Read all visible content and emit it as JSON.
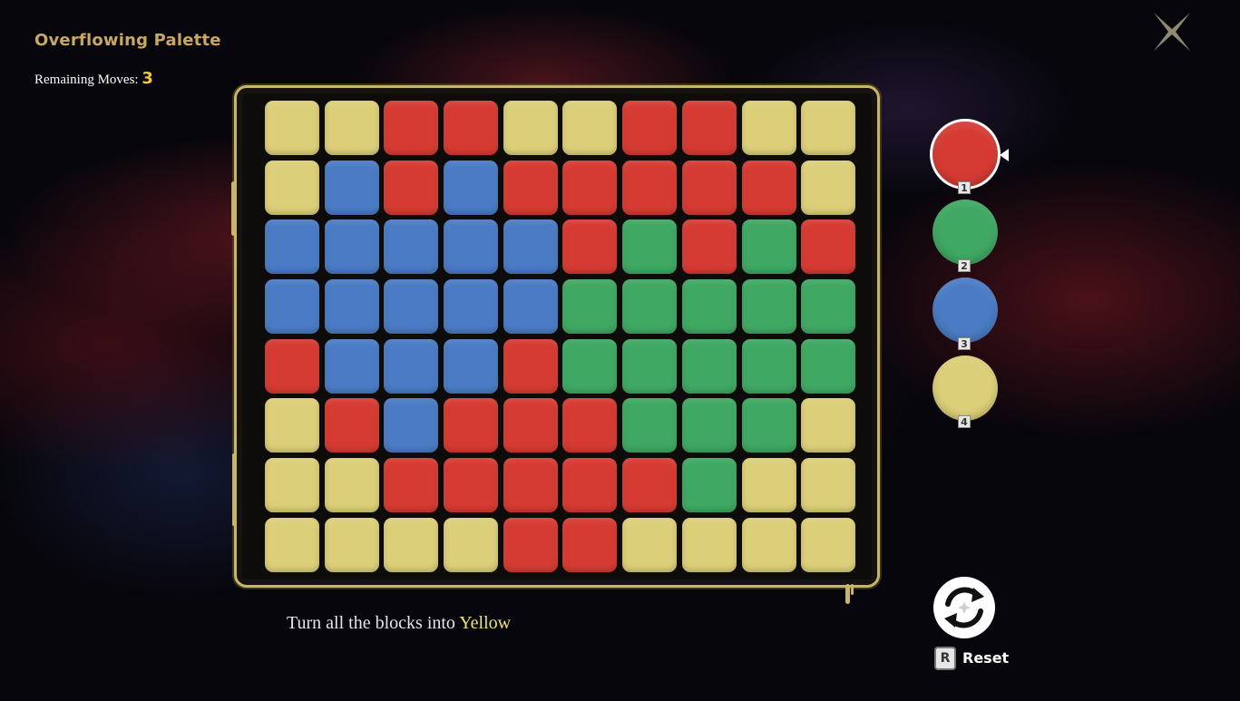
{
  "game": {
    "title": "Overflowing Palette",
    "moves_label": "Remaining Moves:",
    "moves_value": "3"
  },
  "colors": {
    "R": "#d53b33",
    "G": "#3fa863",
    "B": "#4a7bc4",
    "Y": "#dccf79"
  },
  "grid": {
    "rows": 8,
    "cols": 10,
    "cells": [
      [
        "Y",
        "Y",
        "R",
        "R",
        "Y",
        "Y",
        "R",
        "R",
        "Y",
        "Y"
      ],
      [
        "Y",
        "B",
        "R",
        "B",
        "R",
        "R",
        "R",
        "R",
        "R",
        "Y"
      ],
      [
        "B",
        "B",
        "B",
        "B",
        "B",
        "R",
        "G",
        "R",
        "G",
        "R"
      ],
      [
        "B",
        "B",
        "B",
        "B",
        "B",
        "G",
        "G",
        "G",
        "G",
        "G"
      ],
      [
        "R",
        "B",
        "B",
        "B",
        "R",
        "G",
        "G",
        "G",
        "G",
        "G"
      ],
      [
        "Y",
        "R",
        "B",
        "R",
        "R",
        "R",
        "G",
        "G",
        "G",
        "Y"
      ],
      [
        "Y",
        "Y",
        "R",
        "R",
        "R",
        "R",
        "R",
        "G",
        "Y",
        "Y"
      ],
      [
        "Y",
        "Y",
        "Y",
        "Y",
        "R",
        "R",
        "Y",
        "Y",
        "Y",
        "Y"
      ]
    ]
  },
  "palette": {
    "selected_index": 0,
    "items": [
      {
        "key": "1",
        "color": "R"
      },
      {
        "key": "2",
        "color": "G"
      },
      {
        "key": "3",
        "color": "B"
      },
      {
        "key": "4",
        "color": "Y"
      }
    ]
  },
  "goal": {
    "prefix": "Turn all the blocks into ",
    "target": "Yellow"
  },
  "reset": {
    "key": "R",
    "label": "Reset"
  },
  "icons": {
    "close": "close-x-icon",
    "reset": "refresh-cycle-icon"
  }
}
